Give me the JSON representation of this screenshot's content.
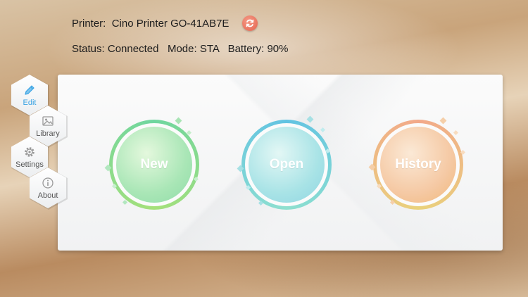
{
  "header": {
    "printer_label": "Printer:",
    "printer_name": "Cino Printer GO-41AB7E",
    "status_label": "Status:",
    "status_value": "Connected",
    "mode_label": "Mode:",
    "mode_value": "STA",
    "battery_label": "Battery:",
    "battery_value": "90%",
    "refresh_icon": "refresh-icon",
    "refresh_color": "#e8664f"
  },
  "sidebar": {
    "items": [
      {
        "label": "Edit",
        "icon": "pencil-icon",
        "active": true
      },
      {
        "label": "Library",
        "icon": "image-icon",
        "active": false
      },
      {
        "label": "Settings",
        "icon": "gear-icon",
        "active": false
      },
      {
        "label": "About",
        "icon": "info-icon",
        "active": false
      }
    ],
    "active_color": "#3aa3e3"
  },
  "main": {
    "actions": [
      {
        "label": "New",
        "color": "#7fd88f"
      },
      {
        "label": "Open",
        "color": "#7cd3e0"
      },
      {
        "label": "History",
        "color": "#f0b87a"
      }
    ]
  }
}
